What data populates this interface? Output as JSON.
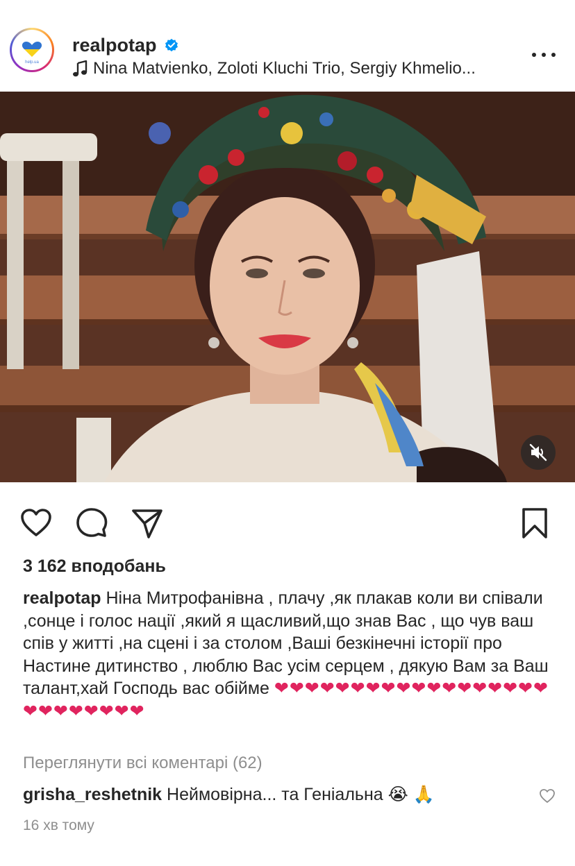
{
  "post": {
    "username": "realpotap",
    "verified": true,
    "avatar_text": "help.ua",
    "music": "Nina Matvienko, Zoloti Kluchi Trio, Sergiy Khmelio...",
    "likes": "3 162 вподобань",
    "caption_user": "realpotap",
    "caption_text": " Ніна Митрофанівна , плачу ,як плакав коли ви співали ,сонце і голос нації ,який я щасливий,що знав Вас , що чув ваш спів у житті ,на сцені і за столом ,Ваші безкінечні історії про Настине дитинство , люблю Вас усім серцем , дякую Вам за Ваш талант,хай Господь вас обійме ",
    "caption_hearts": "❤❤❤❤❤❤❤❤❤❤❤❤❤❤❤❤❤❤❤❤❤❤❤❤❤❤",
    "view_comments": "Переглянути всі коментарі (62)",
    "comment_user": "grisha_reshetnik",
    "comment_text": " Неймовірна... та Геніальна 😭 🙏",
    "time": "16 хв тому"
  },
  "icons": {
    "like": "heart-outline-icon",
    "comment": "speech-bubble-icon",
    "share": "paper-plane-icon",
    "save": "bookmark-icon",
    "mute": "speaker-muted-icon",
    "more": "ellipsis-icon"
  },
  "colors": {
    "text": "#262626",
    "secondary": "#8e8e8e",
    "verified": "#0095f6",
    "heart": "#e0245e"
  }
}
